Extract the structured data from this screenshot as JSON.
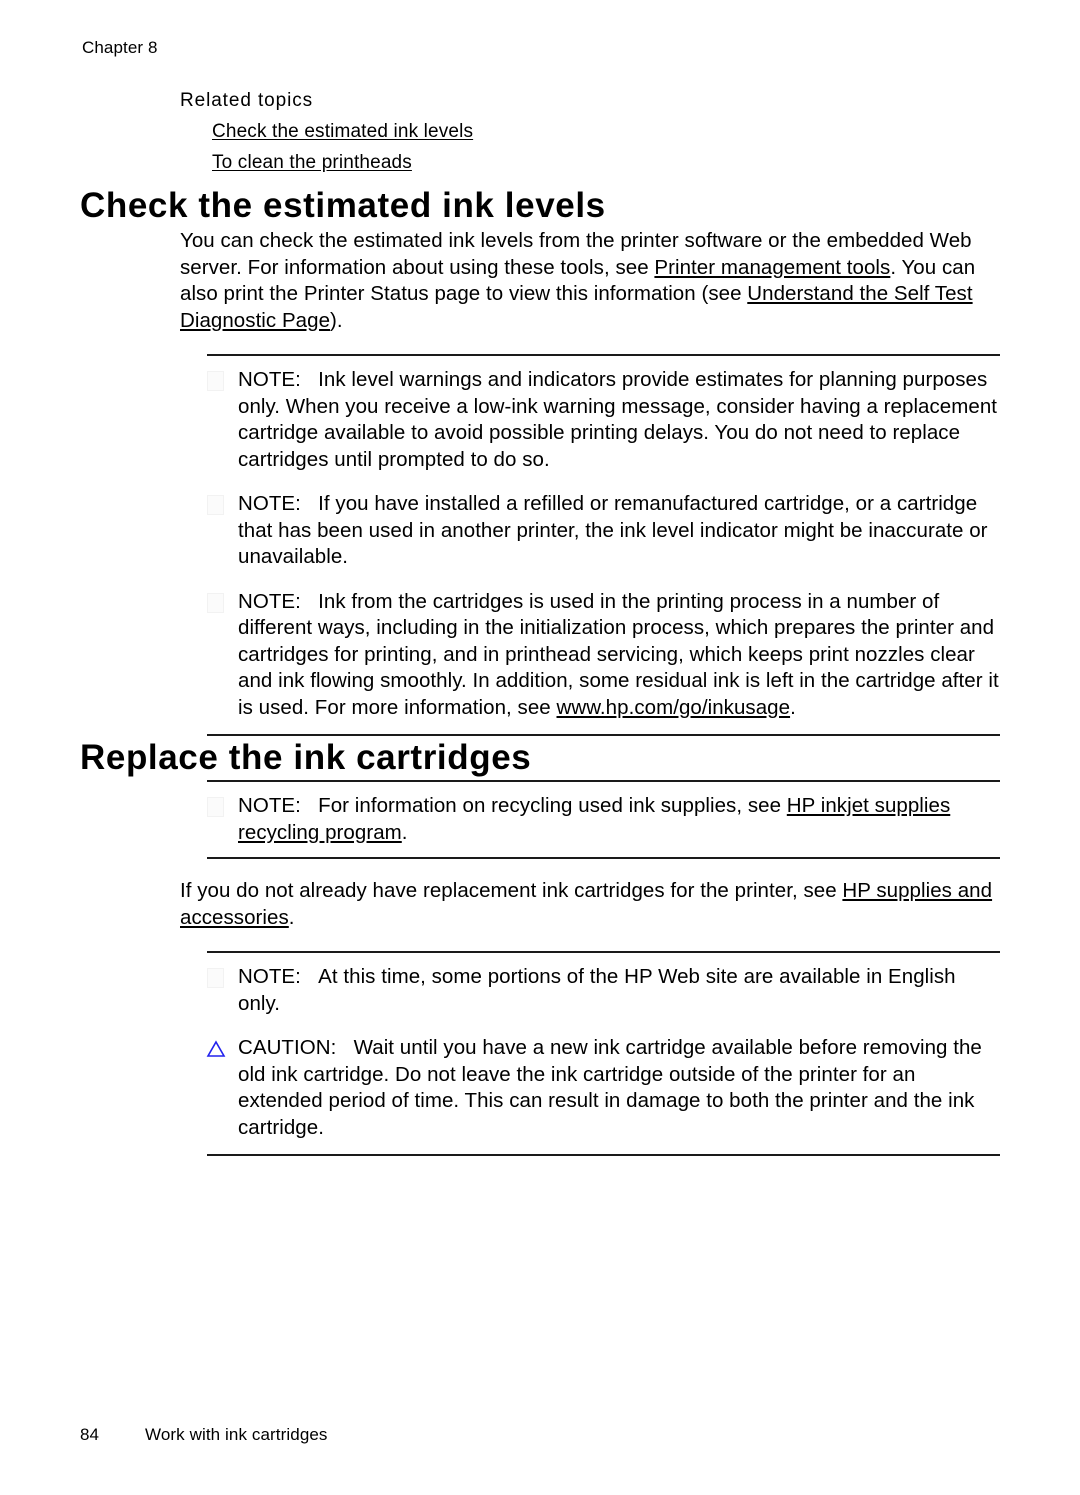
{
  "page": {
    "chapter_header": "Chapter 8",
    "footer_page_number": "84",
    "footer_title": "Work with ink cartridges"
  },
  "related_topics": {
    "title": "Related topics",
    "links": [
      "Check the estimated ink levels",
      "To clean the printheads"
    ]
  },
  "section_check": {
    "heading": "Check the estimated ink levels",
    "intro": {
      "part1": "You can check the estimated ink levels from the printer software or the embedded Web server. For information about using these tools, see ",
      "link1": "Printer management tools",
      "part2": ". You can also print the Printer Status page to view this information (see ",
      "link2": "Understand the Self Test Diagnostic Page",
      "part3": ")."
    },
    "notes": [
      {
        "label": "NOTE:",
        "icon": "note-icon",
        "text": "Ink level warnings and indicators provide estimates for planning purposes only. When you receive a low-ink warning message, consider having a replacement cartridge available to avoid possible printing delays. You do not need to replace cartridges until prompted to do so."
      },
      {
        "label": "NOTE:",
        "icon": "note-icon",
        "text": "If you have installed a refilled or remanufactured cartridge, or a cartridge that has been used in another printer, the ink level indicator might be inaccurate or unavailable."
      },
      {
        "label": "NOTE:",
        "icon": "note-icon",
        "text_before_link": "Ink from the cartridges is used in the printing process in a number of different ways, including in the initialization process, which prepares the printer and cartridges for printing, and in printhead servicing, which keeps print nozzles clear and ink flowing smoothly. In addition, some residual ink is left in the cartridge after it is used. For more information, see ",
        "link": "www.hp.com/go/inkusage",
        "text_after_link": "."
      }
    ]
  },
  "section_replace": {
    "heading": "Replace the ink cartridges",
    "note_recycling": {
      "label": "NOTE:",
      "icon": "note-icon",
      "text_before_link": "For information on recycling used ink supplies, see ",
      "link": "HP inkjet supplies recycling program",
      "text_after_link": "."
    },
    "paragraph_supplies": {
      "part1": "If you do not already have replacement ink cartridges for the printer, see ",
      "link": "HP supplies and accessories",
      "part2": "."
    },
    "note_english": {
      "label": "NOTE:",
      "icon": "note-icon",
      "text": "At this time, some portions of the HP Web site are available in English only."
    },
    "caution": {
      "label": "CAUTION:",
      "icon": "warning-triangle-icon",
      "icon_color": "#2222ee",
      "text": "Wait until you have a new ink cartridge available before removing the old ink cartridge. Do not leave the ink cartridge outside of the printer for an extended period of time. This can result in damage to both the printer and the ink cartridge."
    }
  }
}
